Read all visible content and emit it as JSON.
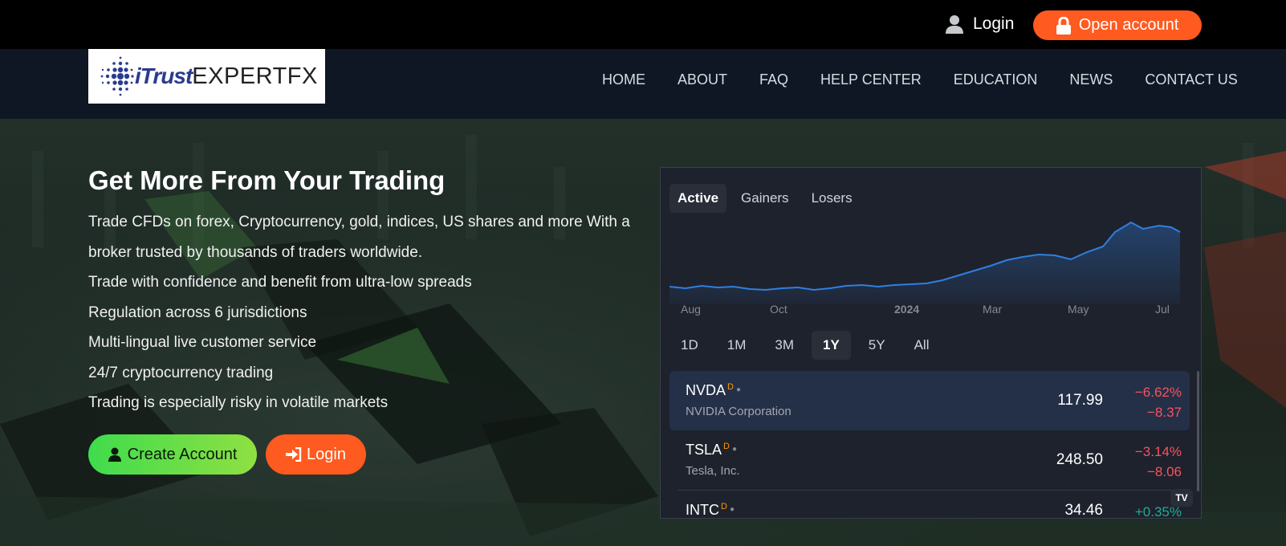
{
  "topbar": {
    "login_label": "Login",
    "open_account_label": "Open account",
    "user_icon": "user-icon",
    "lock_icon": "lock-icon"
  },
  "brand": {
    "logo_part1": "iTrust",
    "logo_part2": "EXPERTFX"
  },
  "nav": {
    "items": [
      {
        "label": "HOME"
      },
      {
        "label": "ABOUT"
      },
      {
        "label": "FAQ"
      },
      {
        "label": "HELP CENTER"
      },
      {
        "label": "EDUCATION"
      },
      {
        "label": "NEWS"
      },
      {
        "label": "CONTACT US"
      }
    ]
  },
  "hero": {
    "title": "Get More From Your Trading",
    "lines": [
      "Trade CFDs on forex, Cryptocurrency, gold, indices, US shares and more With a broker trusted by thousands of traders worldwide.",
      "Trade with confidence and benefit from ultra-low spreads",
      "Regulation across 6 jurisdictions",
      "Multi-lingual live customer service",
      "24/7 cryptocurrency trading",
      "Trading is especially risky in volatile markets"
    ],
    "create_account_label": "Create Account",
    "login_label": "Login"
  },
  "widget": {
    "tabs": [
      {
        "label": "Active",
        "active": true
      },
      {
        "label": "Gainers",
        "active": false
      },
      {
        "label": "Losers",
        "active": false
      }
    ],
    "x_labels": [
      "Aug",
      "Oct",
      "2024",
      "Mar",
      "May",
      "Jul"
    ],
    "ranges": [
      {
        "label": "1D",
        "active": false
      },
      {
        "label": "1M",
        "active": false
      },
      {
        "label": "3M",
        "active": false
      },
      {
        "label": "1Y",
        "active": true
      },
      {
        "label": "5Y",
        "active": false
      },
      {
        "label": "All",
        "active": false
      }
    ],
    "rows": [
      {
        "symbol": "NVDA",
        "flag": "D",
        "name": "NVIDIA Corporation",
        "price": "117.99",
        "change_pct": "−6.62%",
        "change_abs": "−8.37",
        "direction": "down",
        "selected": true
      },
      {
        "symbol": "TSLA",
        "flag": "D",
        "name": "Tesla, Inc.",
        "price": "248.50",
        "change_pct": "−3.14%",
        "change_abs": "−8.06",
        "direction": "down",
        "selected": false
      },
      {
        "symbol": "INTC",
        "flag": "D",
        "name": "",
        "price": "34.46",
        "change_pct": "+0.35%",
        "change_abs": "",
        "direction": "up",
        "selected": false
      }
    ],
    "tv_logo": "TV",
    "line_color": "#2f7fe0"
  },
  "colors": {
    "accent_orange": "#ff5a1f",
    "accent_green": "#3fdc4d",
    "negative": "#f7525f",
    "positive": "#22ab94"
  }
}
